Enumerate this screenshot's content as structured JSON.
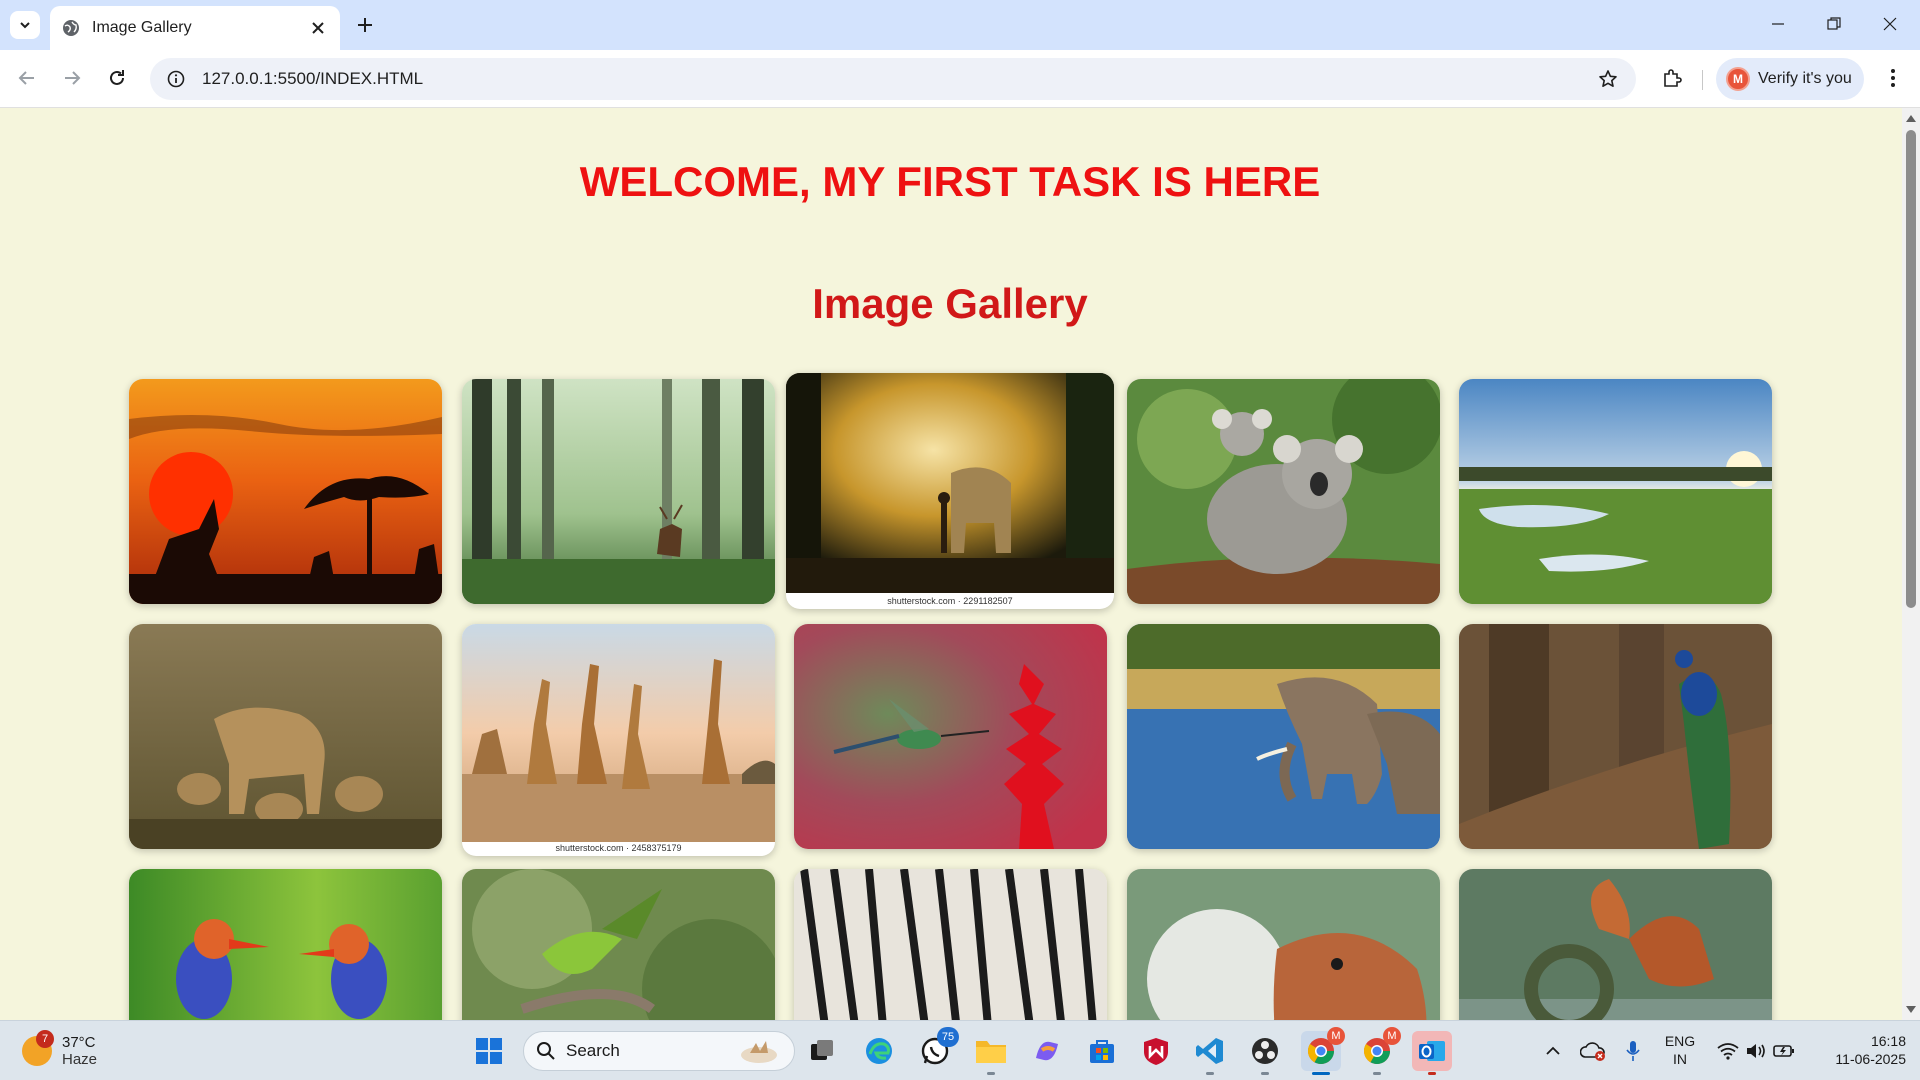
{
  "browser": {
    "tab_title": "Image Gallery",
    "url": "127.0.0.1:5500/INDEX.HTML",
    "profile_label": "Verify it's you",
    "profile_initial": "M"
  },
  "page": {
    "welcome_heading": "WELCOME, MY FIRST TASK IS HERE",
    "gallery_heading": "Image Gallery",
    "images": [
      {
        "subject": "antelope silhouettes at sunset"
      },
      {
        "subject": "deer in misty forest"
      },
      {
        "subject": "person and elephant in sunlit forest",
        "watermark": "shutterstock.com · 2291182507"
      },
      {
        "subject": "koalas on branch"
      },
      {
        "subject": "savanna wetland at sunrise"
      },
      {
        "subject": "lioness with cubs"
      },
      {
        "subject": "giraffes on savanna",
        "watermark": "shutterstock.com · 2458375179"
      },
      {
        "subject": "hummingbird and red flower"
      },
      {
        "subject": "elephants in river"
      },
      {
        "subject": "peacock on log"
      },
      {
        "subject": "kingfishers"
      },
      {
        "subject": "green parrot in flight"
      },
      {
        "subject": "zebras drinking"
      },
      {
        "subject": "squirrel with dandelion"
      },
      {
        "subject": "squirrel at water"
      }
    ]
  },
  "taskbar": {
    "weather_temp": "37°C",
    "weather_desc": "Haze",
    "weather_badge": "7",
    "search_placeholder": "Search",
    "whatsapp_badge": "75",
    "lang_line1": "ENG",
    "lang_line2": "IN",
    "time": "16:18",
    "date": "11-06-2025"
  },
  "colors": {
    "page_bg": "#f5f5dc",
    "heading": "#ee1111",
    "tabstrip": "#d3e3fd"
  }
}
